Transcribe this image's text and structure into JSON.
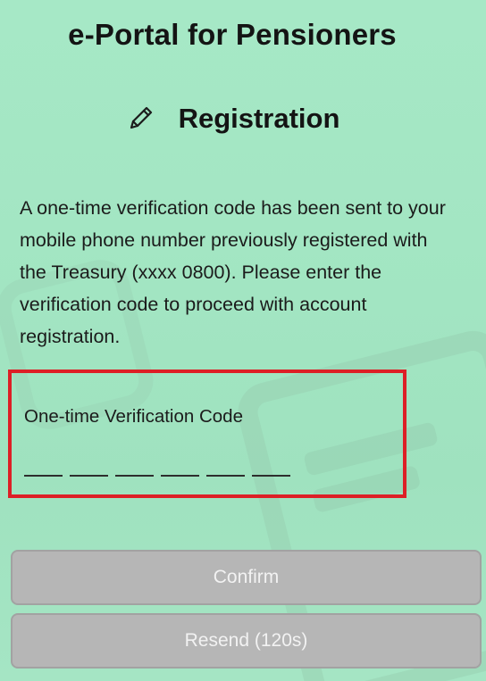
{
  "app_title": "e-Portal for Pensioners",
  "section": {
    "icon": "pencil-icon",
    "title": "Registration"
  },
  "instructions": "A one-time verification code has been sent to your mobile phone number previously registered with the Treasury (xxxx 0800). Please enter the verification code to proceed with account registration.",
  "otp": {
    "label": "One-time Verification Code",
    "slot_count": 6,
    "highlight_color": "#dd1f26"
  },
  "buttons": {
    "confirm_label": "Confirm",
    "resend_label": "Resend (120s)"
  },
  "colors": {
    "background": "#a3e6c3",
    "button_disabled": "#b6b6b6"
  }
}
